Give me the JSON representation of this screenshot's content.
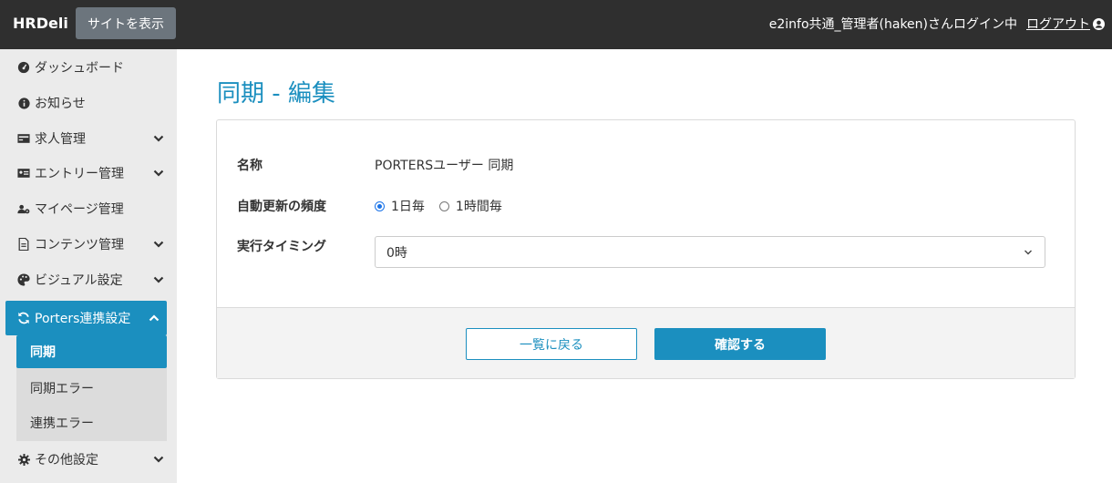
{
  "header": {
    "brand": "HRDeli",
    "view_site_label": "サイトを表示",
    "user_status": "e2info共通_管理者(haken)さんログイン中",
    "logout_label": "ログアウト"
  },
  "sidebar": {
    "items": [
      {
        "label": "ダッシュボード",
        "icon": "dashboard-icon"
      },
      {
        "label": "お知らせ",
        "icon": "info-icon"
      },
      {
        "label": "求人管理",
        "icon": "card-icon"
      },
      {
        "label": "エントリー管理",
        "icon": "id-card-icon"
      },
      {
        "label": "マイページ管理",
        "icon": "user-cog-icon"
      },
      {
        "label": "コンテンツ管理",
        "icon": "file-icon"
      },
      {
        "label": "ビジュアル設定",
        "icon": "palette-icon"
      },
      {
        "label": "Porters連携設定",
        "icon": "sync-icon"
      },
      {
        "label": "その他設定",
        "icon": "gear-icon"
      }
    ],
    "subitems": [
      {
        "label": "同期"
      },
      {
        "label": "同期エラー"
      },
      {
        "label": "連携エラー"
      }
    ]
  },
  "main": {
    "title": "同期 - 編集",
    "form": {
      "name_label": "名称",
      "name_value": "PORTERSユーザー 同期",
      "frequency_label": "自動更新の頻度",
      "frequency_options": [
        "1日毎",
        "1時間毎"
      ],
      "frequency_selected": "1日毎",
      "timing_label": "実行タイミング",
      "timing_value": "0時"
    },
    "buttons": {
      "back_label": "一覧に戻る",
      "confirm_label": "確認する"
    }
  },
  "colors": {
    "accent": "#1b8fbf",
    "topbar": "#2f2f2f",
    "sidebar": "#ebebeb"
  }
}
